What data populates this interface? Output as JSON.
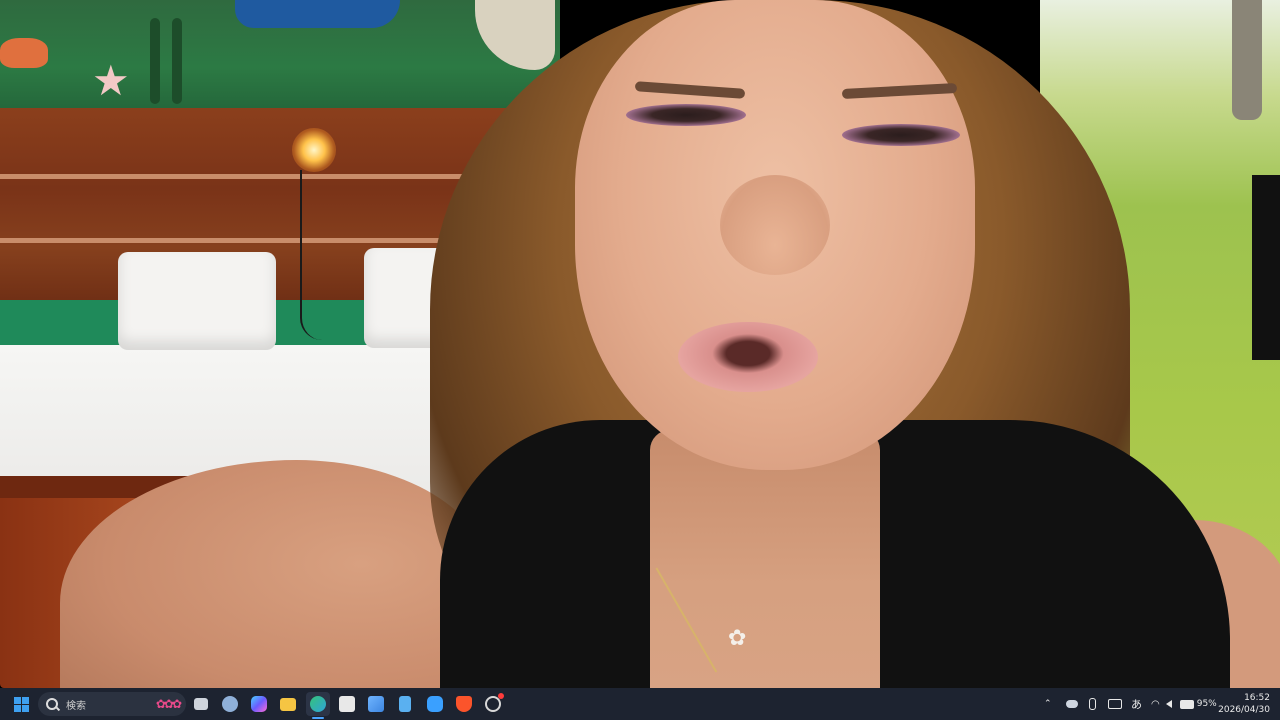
{
  "taskbar": {
    "search_placeholder": "検索",
    "apps": [
      {
        "name": "task-view",
        "color": "#cfd4dc"
      },
      {
        "name": "settings",
        "color": "#8fb0d8"
      },
      {
        "name": "copilot",
        "color": "#6a8cff"
      },
      {
        "name": "file-explorer",
        "color": "#f5c543"
      },
      {
        "name": "edge",
        "color": "#2fa4d8"
      },
      {
        "name": "store",
        "color": "#e8e8e8"
      },
      {
        "name": "file-manager",
        "color": "#3d86e0"
      },
      {
        "name": "notepad",
        "color": "#5ab0f0"
      },
      {
        "name": "onedrive",
        "color": "#3aa0ff"
      },
      {
        "name": "brave",
        "color": "#fb542b"
      },
      {
        "name": "recorder",
        "color": "#d8d8d8"
      }
    ],
    "tray": {
      "ime": "あ",
      "battery_percent": "95%"
    },
    "clock": {
      "time": "16:52",
      "date": "2026/04/30"
    }
  }
}
